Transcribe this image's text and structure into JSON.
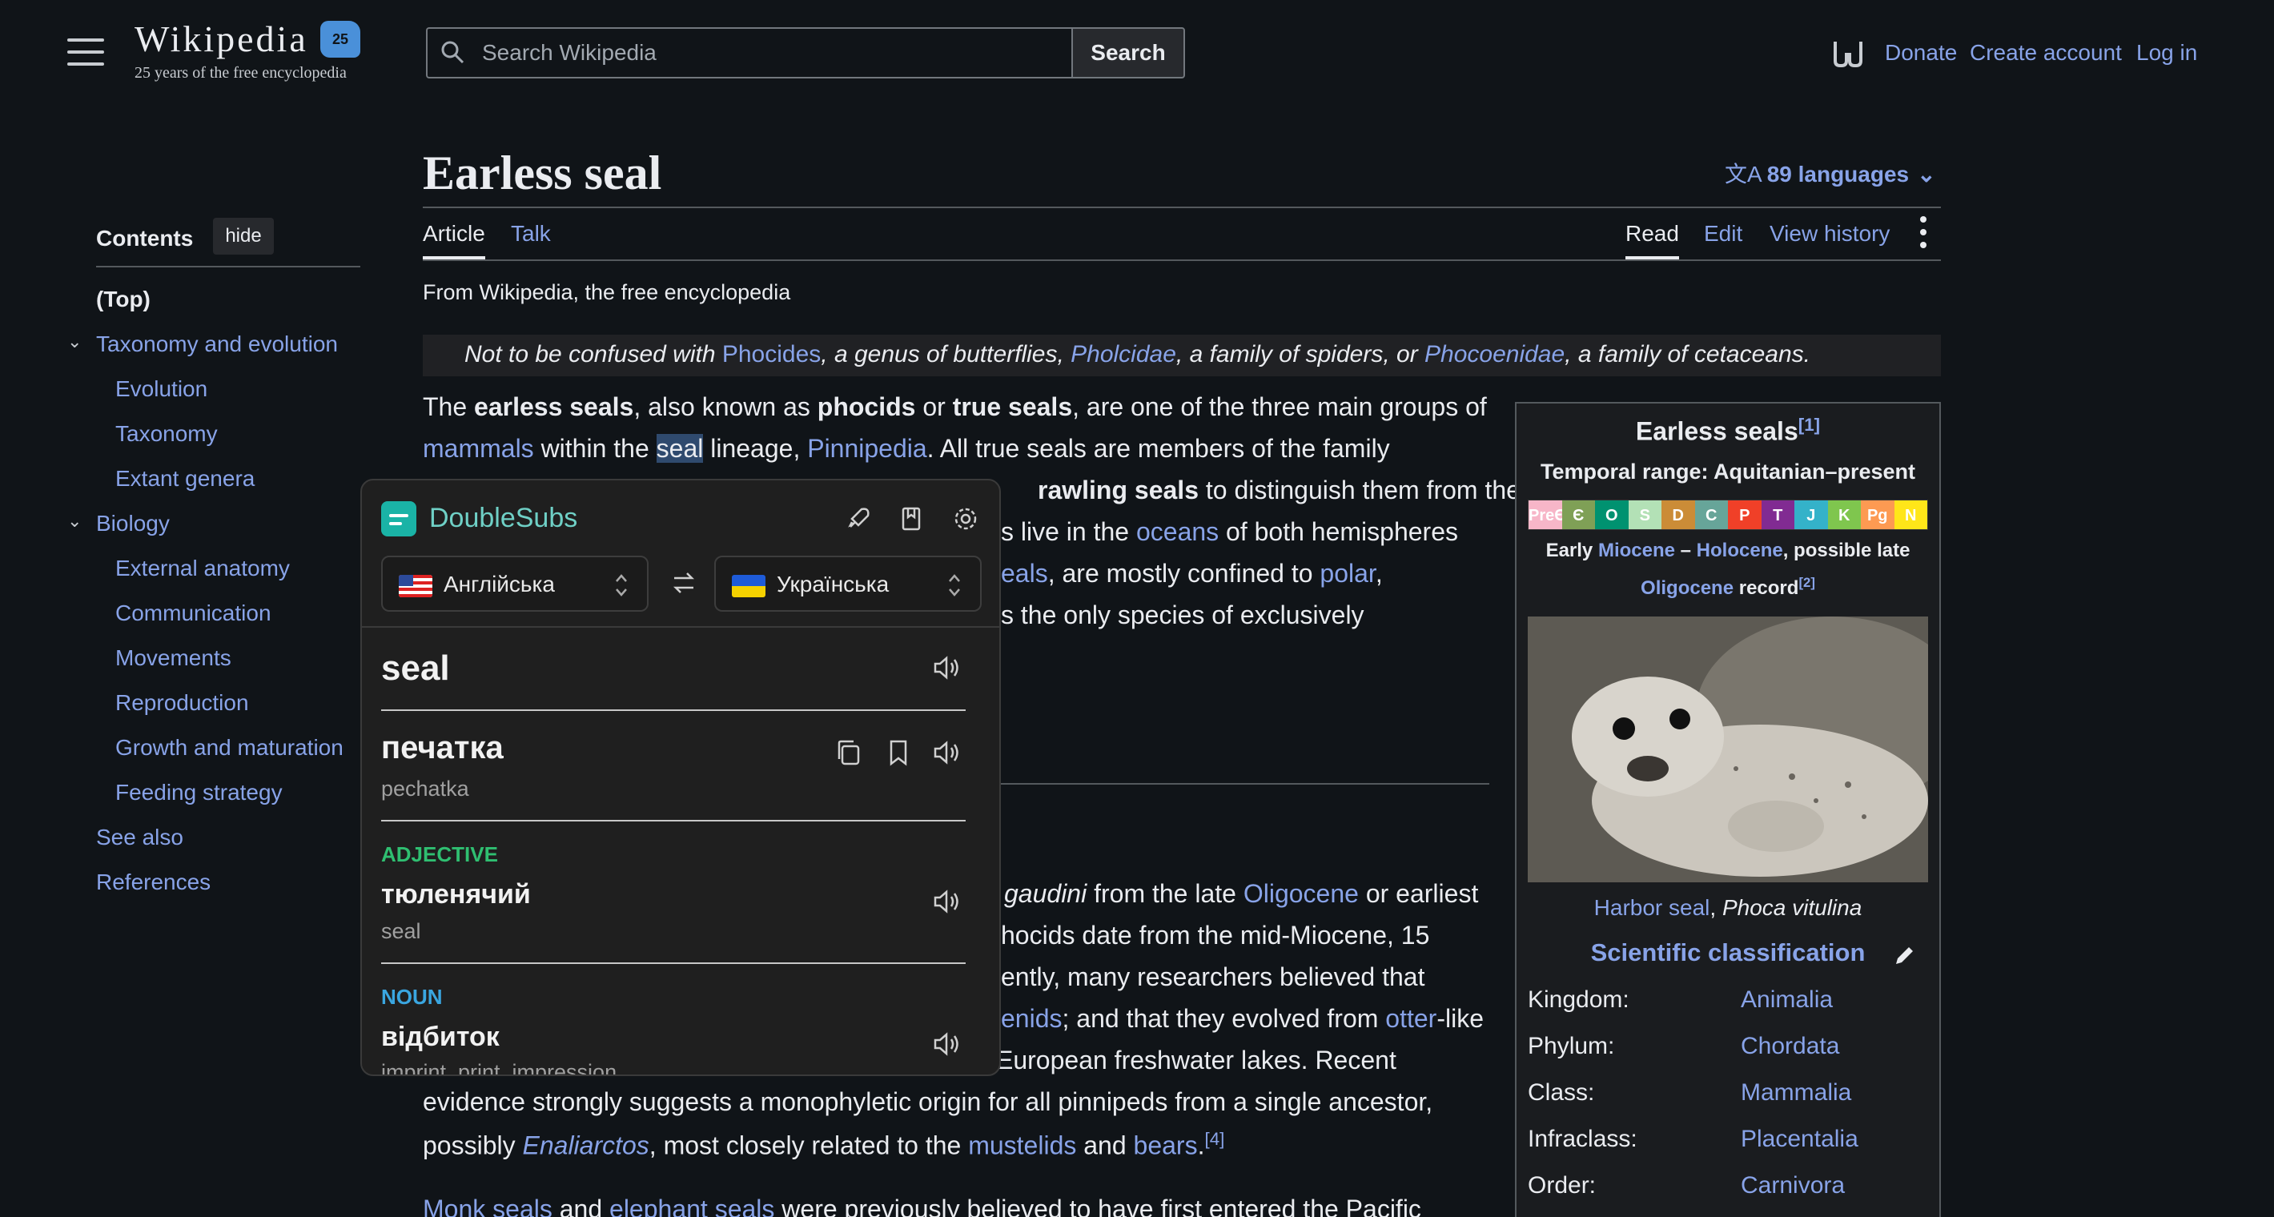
{
  "header": {
    "wordmark": "Wikipedia",
    "badge": "25",
    "tagline": "25 years of the free encyclopedia",
    "search_placeholder": "Search Wikipedia",
    "search_button": "Search",
    "donate": "Donate",
    "create_account": "Create account",
    "log_in": "Log in"
  },
  "toc": {
    "title": "Contents",
    "hide": "hide",
    "top": "(Top)",
    "items": [
      {
        "label": "Taxonomy and evolution"
      },
      {
        "label": "Evolution"
      },
      {
        "label": "Taxonomy"
      },
      {
        "label": "Extant genera"
      },
      {
        "label": "Biology"
      },
      {
        "label": "External anatomy"
      },
      {
        "label": "Communication"
      },
      {
        "label": "Movements"
      },
      {
        "label": "Reproduction"
      },
      {
        "label": "Growth and maturation"
      },
      {
        "label": "Feeding strategy"
      },
      {
        "label": "See also"
      },
      {
        "label": "References"
      }
    ]
  },
  "article": {
    "title": "Earless seal",
    "languages": "89 languages",
    "tabs": {
      "article": "Article",
      "talk": "Talk",
      "read": "Read",
      "edit": "Edit",
      "history": "View history"
    },
    "from": "From Wikipedia, the free encyclopedia",
    "hatnote": {
      "a": "Not to be confused with ",
      "l1": "Phocides",
      "b": ", a genus of butterflies, ",
      "l2": "Pholcidae",
      "c": ", a family of spiders, or ",
      "l3": "Phocoenidae",
      "d": ", a family of cetaceans."
    },
    "p1": {
      "l1_a": "The ",
      "l1_b": "earless seals",
      "l1_c": ", also known as ",
      "l1_d": "phocids",
      "l1_e": " or ",
      "l1_f": "true seals",
      "l1_g": ", are one of the three main groups of",
      "l2_link1": "mammals",
      "l2_a": " within the ",
      "l2_seal": "seal",
      "l2_b": " lineage, ",
      "l2_link2": "Pinnipedia",
      "l2_c": ". All true seals are members of the family",
      "l3_bold": "rawling seals",
      "l3_a": " to distinguish them from the",
      "l4_a": "s live in the ",
      "l4_link": "oceans",
      "l4_b": " of both hemispheres",
      "l5_link1": "eals",
      "l5_a": ", are mostly confined to ",
      "l5_link2": "polar",
      "l5_b": ",",
      "l6_a": "s the only species of exclusively"
    },
    "p2": {
      "l1_it": "gaudini",
      "l1_a": " from the late ",
      "l1_link": "Oligocene",
      "l1_b": " or earliest",
      "l2_a": "hocids date from the mid-Miocene, 15",
      "l3_a": "ently, many researchers believed that",
      "l4_link": "enids",
      "l4_a": "; and that they evolved from ",
      "l4_link2": "otter",
      "l4_b": "-like",
      "l5_a": "European freshwater lakes. Recent",
      "l6_a": "evidence strongly suggests a monophyletic origin for all pinnipeds from a single ancestor,",
      "l7_a": "possibly ",
      "l7_it": "Enaliarctos",
      "l7_b": ", most closely related to the ",
      "l7_link1": "mustelids",
      "l7_c": " and ",
      "l7_link2": "bears",
      "l7_d": ".",
      "l7_ref": "[4]",
      "l8_link1": "Monk seals",
      "l8_a": " and ",
      "l8_link2": "elephant seals",
      "l8_b": " were previously believed to have first entered the Pacific"
    }
  },
  "infobox": {
    "title": "Earless seals",
    "title_ref": "[1]",
    "range": "Temporal range: Aquitanian–present",
    "timeline": [
      "PreЄ",
      "Є",
      "O",
      "S",
      "D",
      "C",
      "P",
      "T",
      "J",
      "K",
      "Pg",
      "N"
    ],
    "timeline_colors": [
      "#f7b6c8",
      "#7fa056",
      "#009270",
      "#b3e1b6",
      "#cb8c37",
      "#67a599",
      "#f04028",
      "#812b92",
      "#34b2c9",
      "#7fc64e",
      "#fd9a52",
      "#ffe619"
    ],
    "note1_a": "Early ",
    "note1_link1": "Miocene",
    "note1_b": " – ",
    "note1_link2": "Holocene",
    "note1_c": ", possible late",
    "note2_link": "Oligocene",
    "note2_a": " record",
    "note2_ref": "[2]",
    "caption_link": "Harbor seal",
    "caption_sep": ", ",
    "caption_it": "Phoca vitulina",
    "sci_class": "Scientific classification",
    "rows": [
      {
        "key": "Kingdom:",
        "val": "Animalia"
      },
      {
        "key": "Phylum:",
        "val": "Chordata"
      },
      {
        "key": "Class:",
        "val": "Mammalia"
      },
      {
        "key": "Infraclass:",
        "val": "Placentalia"
      },
      {
        "key": "Order:",
        "val": "Carnivora"
      }
    ]
  },
  "popup": {
    "app_name": "DoubleSubs",
    "source_lang": "Англійська",
    "target_lang": "Українська",
    "word": "seal",
    "translation": "печатка",
    "translit": "pechatka",
    "senses": [
      {
        "pos": "ADJECTIVE",
        "pos_color": "#2fbf71",
        "word": "тюленячий",
        "gloss": "seal"
      },
      {
        "pos": "NOUN",
        "pos_color": "#3aa6e0",
        "word": "відбиток",
        "gloss": "imprint, print, impression"
      }
    ]
  }
}
